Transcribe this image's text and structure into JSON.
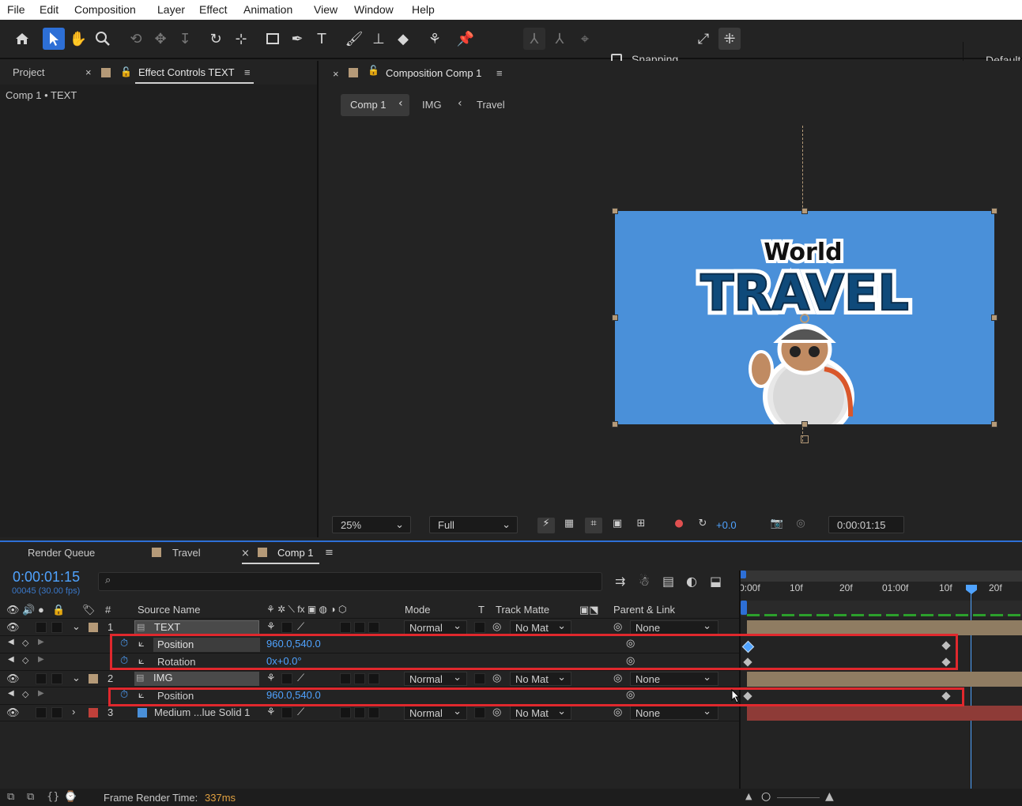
{
  "menu": [
    "File",
    "Edit",
    "Composition",
    "Layer",
    "Effect",
    "Animation",
    "View",
    "Window",
    "Help"
  ],
  "toolbar": {
    "snapping_label": "Snapping",
    "workspace_label": "Default"
  },
  "left_panel": {
    "tab_project": "Project",
    "tab_close": "×",
    "tab_effect_controls": "Effect Controls TEXT",
    "subtitle": "Comp 1 • TEXT"
  },
  "comp_panel": {
    "close": "×",
    "title": "Composition Comp 1",
    "breadcrumbs": [
      {
        "label": "Comp 1"
      },
      {
        "label": "IMG"
      },
      {
        "label": "Travel"
      }
    ],
    "canvas_text_small": "World",
    "canvas_text_big": "TRAVEL",
    "zoom": "25%",
    "resolution": "Full",
    "exposure": "+0.0",
    "timecode": "0:00:01:15"
  },
  "timeline": {
    "tabs": [
      {
        "label": "Render Queue"
      },
      {
        "label": "Travel"
      },
      {
        "label": "Comp 1"
      }
    ],
    "tab_close": "×",
    "current_time": "0:00:01:15",
    "frame_info": "00045 (30.00 fps)",
    "search_placeholder": "",
    "headers": {
      "num": "#",
      "source_name": "Source Name",
      "mode": "Mode",
      "t": "T",
      "track_matte": "Track Matte",
      "parent": "Parent & Link"
    },
    "ruler_labels": [
      "0:00f",
      "10f",
      "20f",
      "01:00f",
      "10f",
      "20f"
    ],
    "layers": [
      {
        "num": "1",
        "name": "TEXT",
        "mode": "Normal",
        "matte": "No Mat",
        "parent": "None"
      },
      {
        "num": "2",
        "name": "IMG",
        "mode": "Normal",
        "matte": "No Mat",
        "parent": "None"
      },
      {
        "num": "3",
        "name": "Medium ...lue Solid 1",
        "mode": "Normal",
        "matte": "No Mat",
        "parent": "None"
      }
    ],
    "props": [
      {
        "name": "Position",
        "value": "960.0,540.0"
      },
      {
        "name": "Rotation",
        "value": "0x+0.0°"
      },
      {
        "name": "Position",
        "value": "960.0,540.0"
      }
    ],
    "footer_label": "Frame Render Time:",
    "footer_value": "337ms"
  },
  "colors": {
    "accent": "#2d6fd6",
    "canvas_blue": "#4a90d9",
    "highlight_red": "#e0282d",
    "value_blue": "#4fa3ff",
    "layer_tan": "#b59a78",
    "layer_red": "#c0403a"
  }
}
